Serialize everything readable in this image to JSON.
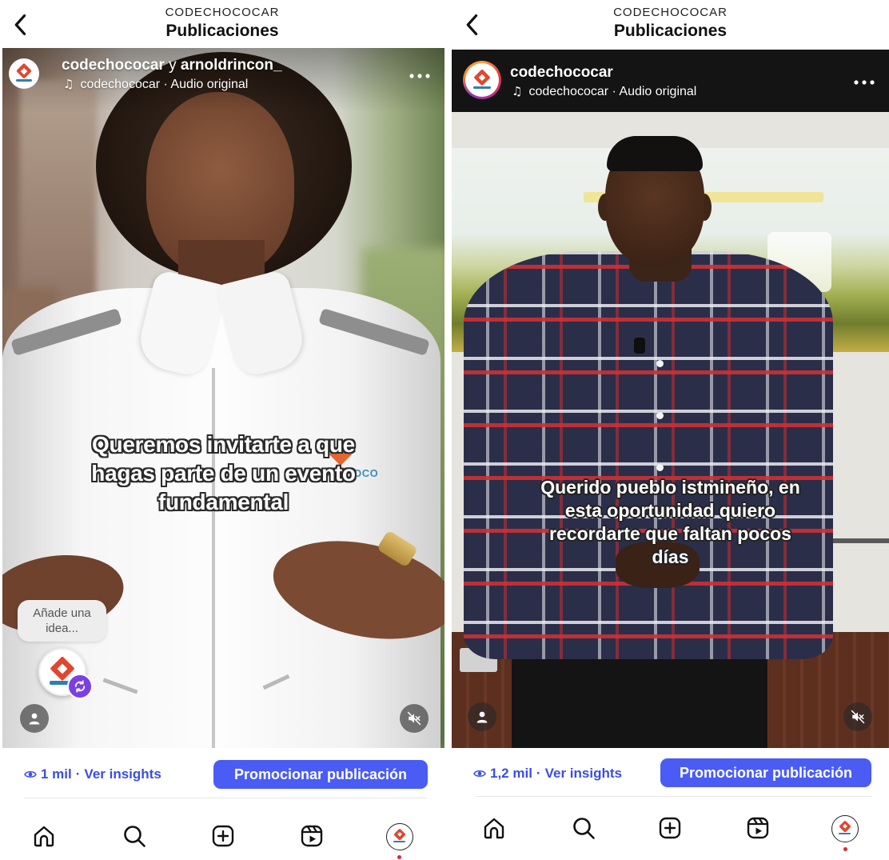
{
  "colors": {
    "accent": "#4a5cf4",
    "link": "#3b4de2",
    "notification_dot": "#e0243a",
    "caption_outline": "#2a2a2a"
  },
  "icons": {
    "back": "chevron-left-icon",
    "audio": "music-note-icon",
    "more": "more-horizontal-icon",
    "views": "eye-icon",
    "tagged_people": "person-icon",
    "sound": "speaker-muted-icon",
    "remix": "sync-icon"
  },
  "panels": [
    {
      "header": {
        "account": "CODECHOCOCAR",
        "title": "Publicaciones"
      },
      "post": {
        "author": "codechococar",
        "connector": " y ",
        "collaborator": "arnoldrincon_",
        "audio_note": "♫",
        "audio": "codechococar · Audio original",
        "caption": [
          "Queremos invitarte a que",
          "hagas parte de un evento",
          "fundamental"
        ],
        "jacket_logo": "CODECHOCO",
        "idea_bubble": "Añade una idea...",
        "muted": true
      },
      "stats": {
        "views": "1 mil",
        "separator": " · ",
        "insights_label": "Ver insights"
      },
      "promote_label": "Promocionar publicación"
    },
    {
      "header": {
        "account": "CODECHOCOCAR",
        "title": "Publicaciones"
      },
      "post": {
        "author": "codechococar",
        "audio_note": "♫",
        "audio": "codechococar · Audio original",
        "caption": [
          "Querido pueblo istmineño, en",
          "esta oportunidad quiero",
          "recordarte que faltan pocos",
          "días"
        ],
        "has_story_ring": true,
        "muted": true
      },
      "stats": {
        "views": "1,2 mil",
        "separator": " · ",
        "insights_label": "Ver insights"
      },
      "promote_label": "Promocionar publicación"
    }
  ],
  "nav": {
    "items": [
      "home-icon",
      "search-icon",
      "plus-square-icon",
      "reels-icon",
      "profile-avatar"
    ],
    "active": "profile-avatar",
    "profile_has_notification": true
  }
}
